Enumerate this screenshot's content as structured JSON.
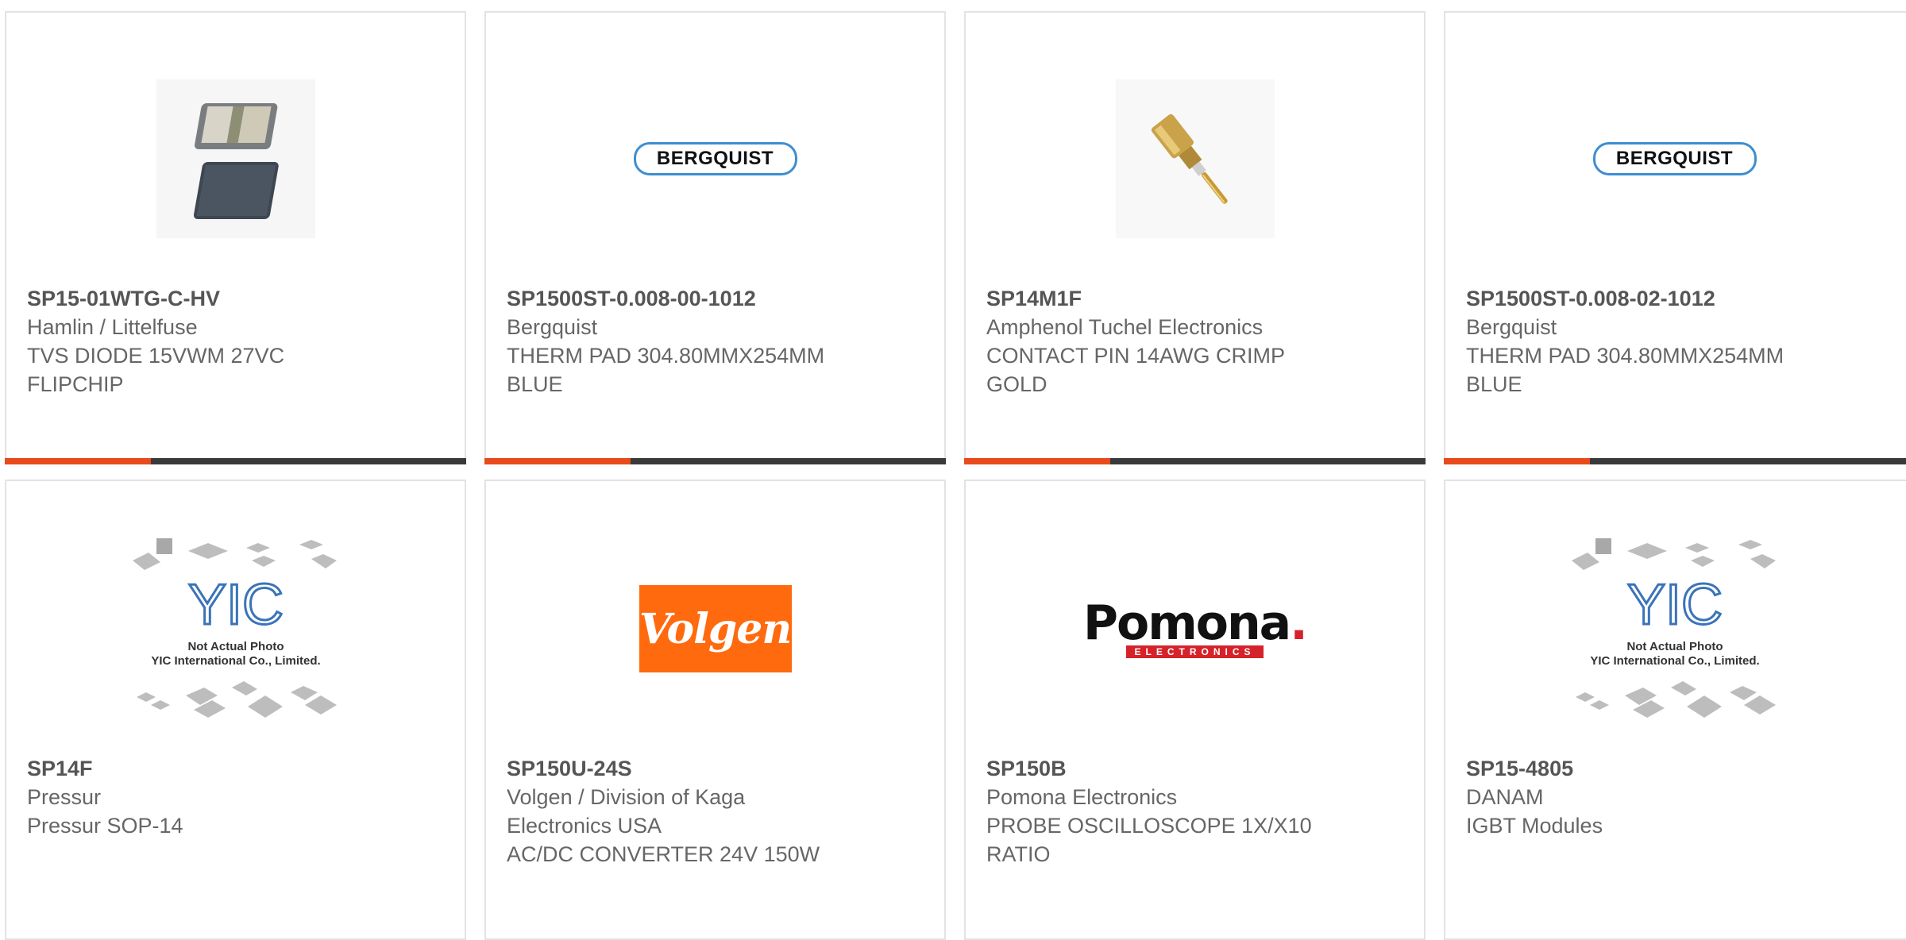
{
  "products": [
    {
      "part_number": "SP15-01WTG-C-HV",
      "manufacturer": "Hamlin / Littelfuse",
      "description_lines": [
        "TVS DIODE 15VWM 27VC",
        "FLIPCHIP"
      ],
      "image": "tvs-diode-photo"
    },
    {
      "part_number": "SP1500ST-0.008-00-1012",
      "manufacturer": "Bergquist",
      "description_lines": [
        "THERM PAD 304.80MMX254MM",
        "BLUE"
      ],
      "image": "bergquist-logo",
      "logo_text": "BERGQUIST"
    },
    {
      "part_number": "SP14M1F",
      "manufacturer": "Amphenol Tuchel Electronics",
      "description_lines": [
        "CONTACT PIN 14AWG CRIMP",
        "GOLD"
      ],
      "image": "contact-pin-photo"
    },
    {
      "part_number": "SP1500ST-0.008-02-1012",
      "manufacturer": "Bergquist",
      "description_lines": [
        "THERM PAD 304.80MMX254MM",
        "BLUE"
      ],
      "image": "bergquist-logo",
      "logo_text": "BERGQUIST"
    },
    {
      "part_number": "SP14F",
      "manufacturer": "Pressur",
      "description_lines": [
        "Pressur SOP-14"
      ],
      "image": "yic-placeholder",
      "placeholder_caption": [
        "Not Actual Photo",
        "YIC International Co., Limited."
      ]
    },
    {
      "part_number": "SP150U-24S",
      "manufacturer_lines": [
        "Volgen / Division of Kaga",
        "Electronics USA"
      ],
      "description_lines": [
        "AC/DC CONVERTER 24V 150W"
      ],
      "image": "volgen-logo",
      "logo_text": "Volgen"
    },
    {
      "part_number": "SP150B",
      "manufacturer": "Pomona Electronics",
      "description_lines": [
        "PROBE OSCILLOSCOPE 1X/X10",
        "RATIO"
      ],
      "image": "pomona-logo",
      "logo_text": "Pomona",
      "logo_sub": "ELECTRONICS"
    },
    {
      "part_number": "SP15-4805",
      "manufacturer": "DANAM",
      "description_lines": [
        "IGBT Modules"
      ],
      "image": "yic-placeholder",
      "placeholder_caption": [
        "Not Actual Photo",
        "YIC International Co., Limited."
      ]
    }
  ],
  "colors": {
    "accent": "#e84a1c",
    "bar": "#3a3a3a",
    "card_border": "#e3e3e3",
    "bergquist_blue": "#3d8ed1",
    "volgen_orange": "#ff6a0e",
    "pomona_red": "#d6222a"
  }
}
